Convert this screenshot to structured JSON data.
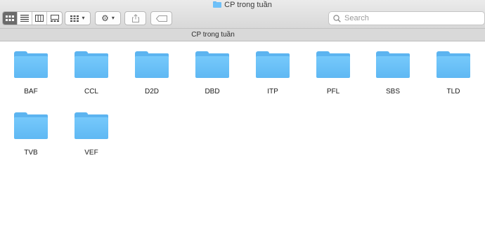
{
  "window": {
    "title": "CP trong tuần"
  },
  "toolbar": {
    "view_modes": [
      "icon-view-icon",
      "list-view-icon",
      "column-view-icon",
      "gallery-view-icon"
    ],
    "active_view": "icon-view-icon",
    "group_button_icon": "group-grid-icon",
    "action_button_icon": "gear-icon",
    "share_button_icon": "share-icon",
    "tag_button_icon": "tag-icon"
  },
  "search": {
    "placeholder": "Search"
  },
  "pathbar": {
    "label": "CP trong tuần"
  },
  "folders": [
    {
      "name": "BAF"
    },
    {
      "name": "CCL"
    },
    {
      "name": "D2D"
    },
    {
      "name": "DBD"
    },
    {
      "name": "ITP"
    },
    {
      "name": "PFL"
    },
    {
      "name": "SBS"
    },
    {
      "name": "TLD"
    },
    {
      "name": "TVB"
    },
    {
      "name": "VEF"
    }
  ],
  "colors": {
    "folder": "#6ec0f8",
    "toolbar_bg": "#e3e3e3",
    "pathbar_bg": "#d9d9d9"
  }
}
